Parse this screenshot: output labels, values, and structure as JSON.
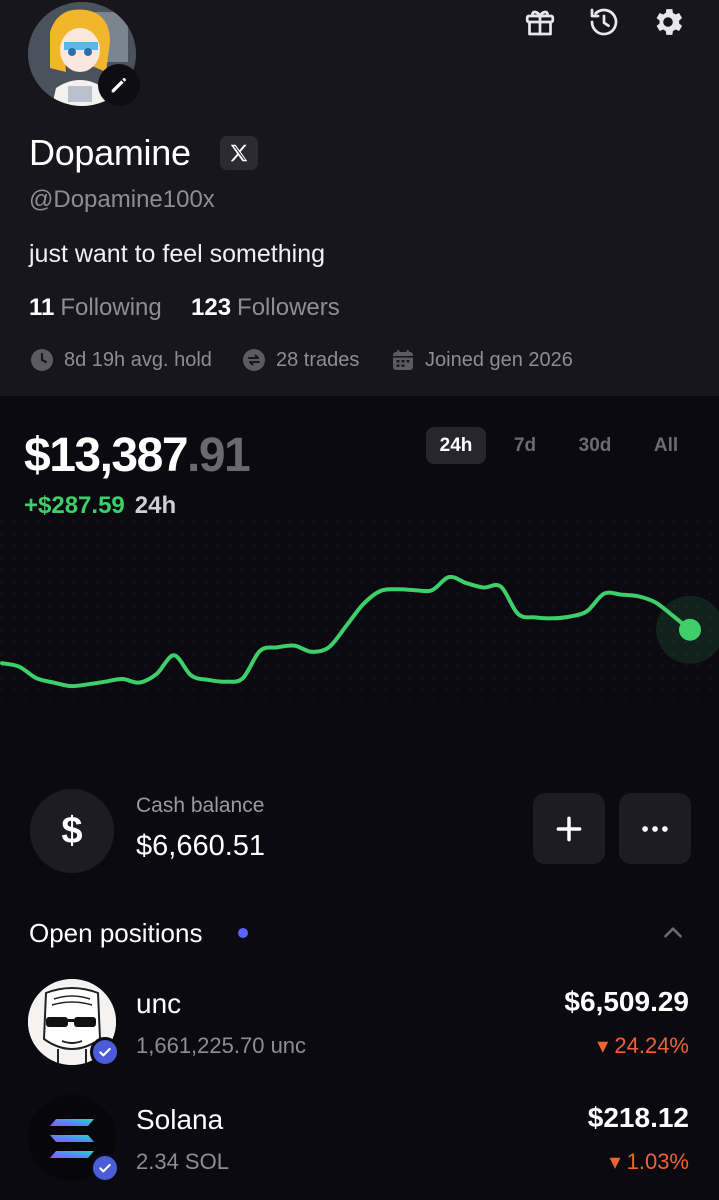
{
  "profile": {
    "name": "Dopamine",
    "handle": "@Dopamine100x",
    "bio": "just want to feel something",
    "following_count": "11",
    "following_label": "Following",
    "followers_count": "123",
    "followers_label": "Followers",
    "avg_hold": "8d 19h avg. hold",
    "trades": "28 trades",
    "joined": "Joined gen 2026"
  },
  "header_icons": [
    "gift-icon",
    "history-icon",
    "gear-icon"
  ],
  "portfolio": {
    "balance_main": "$13,387",
    "balance_cents": ".91",
    "change_value": "+$287.59",
    "change_period": "24h",
    "ranges": [
      "24h",
      "7d",
      "30d",
      "All"
    ],
    "selected_range": "24h"
  },
  "chart_data": {
    "type": "line",
    "x": [
      0,
      1,
      2,
      3,
      4,
      5,
      6,
      7,
      8,
      9,
      10,
      11,
      12,
      13,
      14,
      15,
      16,
      17,
      18,
      19,
      20,
      21,
      22,
      23,
      24,
      25,
      26,
      27,
      28,
      29,
      30,
      31,
      32,
      33,
      34,
      35,
      36,
      37,
      38,
      39,
      40
    ],
    "values": [
      11.0,
      10.6,
      9.3,
      8.8,
      8.4,
      8.6,
      8.9,
      9.2,
      8.8,
      9.8,
      11.9,
      9.6,
      9.1,
      8.9,
      9.3,
      12.4,
      12.8,
      13.0,
      12.3,
      12.8,
      15.2,
      17.7,
      19.2,
      19.4,
      19.3,
      19.3,
      20.8,
      20.1,
      19.6,
      19.7,
      16.6,
      16.2,
      16.1,
      16.3,
      16.9,
      18.9,
      18.8,
      18.6,
      17.9,
      16.4,
      14.8
    ],
    "color": "#3ecf6a",
    "grid": false,
    "xlabel": "",
    "ylabel": ""
  },
  "cash": {
    "symbol": "$",
    "label": "Cash balance",
    "value": "$6,660.51",
    "add_icon": "plus-icon",
    "more_icon": "more-icon"
  },
  "positions": {
    "title": "Open positions",
    "items": [
      {
        "name": "unc",
        "amount": "1,661,225.70 unc",
        "value": "$6,509.29",
        "change": "▾ 24.24%"
      },
      {
        "name": "Solana",
        "amount": "2.34 SOL",
        "value": "$218.12",
        "change": "▾ 1.03%"
      }
    ]
  },
  "colors": {
    "background": "#0b0a10",
    "header_background": "#17161d",
    "accent_green": "#3ecf6a",
    "negative_orange": "#f0622f",
    "status_dot": "#5b63ff"
  }
}
